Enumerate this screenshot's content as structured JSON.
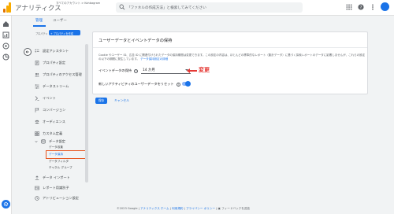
{
  "app": {
    "title": "アナリティクス",
    "account_crumb": "すべてのアカウント > Kohbagram",
    "account_name": "Kohbagram"
  },
  "search": {
    "placeholder": "「ファネルの作成方法」と検索してみてください"
  },
  "tabs": [
    {
      "label": "管理"
    },
    {
      "label": "ユーザー"
    }
  ],
  "property": {
    "label": "プロパティ",
    "create_button": "+ プロパティを作成"
  },
  "nav": {
    "items": [
      {
        "label": "設定アシスタント",
        "icon": "checklist-icon"
      },
      {
        "label": "プロパティ設定",
        "icon": "document-icon"
      },
      {
        "label": "プロパティのアクセス管理",
        "icon": "people-icon"
      },
      {
        "label": "データストリーム",
        "icon": "streams-icon"
      },
      {
        "label": "イベント",
        "icon": "event-icon"
      },
      {
        "label": "コンバージョン",
        "icon": "flag-icon"
      },
      {
        "label": "オーディエンス",
        "icon": "audience-icon"
      },
      {
        "label": "カスタム定義",
        "icon": "custom-definitions-icon"
      },
      {
        "label": "データ設定",
        "icon": "database-icon"
      },
      {
        "label": "データ インポート",
        "icon": "upload-icon"
      },
      {
        "label": "レポート用識別子",
        "icon": "identity-icon"
      },
      {
        "label": "アトリビューション設定",
        "icon": "attribution-icon"
      }
    ],
    "sub_items": [
      "データ収集",
      "データ保持",
      "データフィルタ",
      "チャネル グループ"
    ]
  },
  "card": {
    "title": "ユーザーデータとイベントデータの保持",
    "description": "Cookie やユーザー ID、広告 ID に関連付けられたデータの保持期間は変更できます。この設定の内容は、ほとんどの標準的なレポート（集計データ）に基づく探索レポートのデータに影響しませんが、これらの設定の以下の期間に発生しています。",
    "description_link": "データ保持設定の詳細",
    "event_retention_label": "イベントデータの保持",
    "event_retention_value": "14 か月",
    "reset_label": "新しいアクティビティのユーザーデータをリセット",
    "reset_enabled": true
  },
  "annotation": {
    "text": "変更",
    "color": "#e53935"
  },
  "actions": {
    "save": "保存",
    "cancel": "キャンセル"
  },
  "footer": {
    "copyright": "©2023 Google |",
    "home_link": "アナリティクス ホーム",
    "terms_link": "利用規約",
    "privacy_link": "プライバシー ポリシー",
    "feedback": "フィードバックを送信"
  },
  "colors": {
    "accent": "#1a73e8",
    "highlight": "#e8541d"
  }
}
